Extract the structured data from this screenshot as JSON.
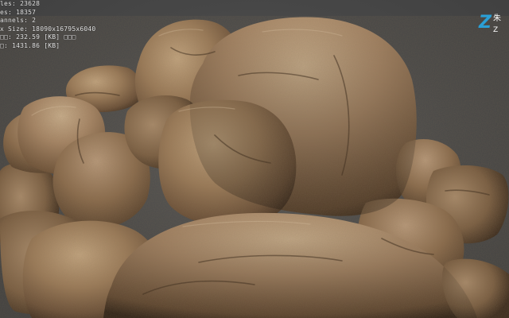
{
  "viewport": {
    "background": "#4a4a4a",
    "subject": "rock-cluster-model"
  },
  "stats": {
    "line1": {
      "label": "les:",
      "value": "23628"
    },
    "line2": {
      "label": "es:",
      "value": "18357"
    },
    "line3": {
      "label": "annels:",
      "value": "2"
    },
    "line4": {
      "label": "x Size:",
      "value": "18090x16795x6040"
    },
    "line5": {
      "label": "□□:",
      "value": "232.59",
      "unit": "[KB] □□□"
    },
    "line6": {
      "label": "□:",
      "value": "1431.86",
      "unit": "[KB]"
    }
  },
  "logo": {
    "mark": "Z",
    "cn": "朱",
    "sub": "Z",
    "color": "#2a9fd6"
  },
  "colors": {
    "rock_light": "#b39572",
    "rock_mid": "#8d7052",
    "rock_dark": "#4f3a28",
    "rock_shadow": "#2e2219"
  }
}
